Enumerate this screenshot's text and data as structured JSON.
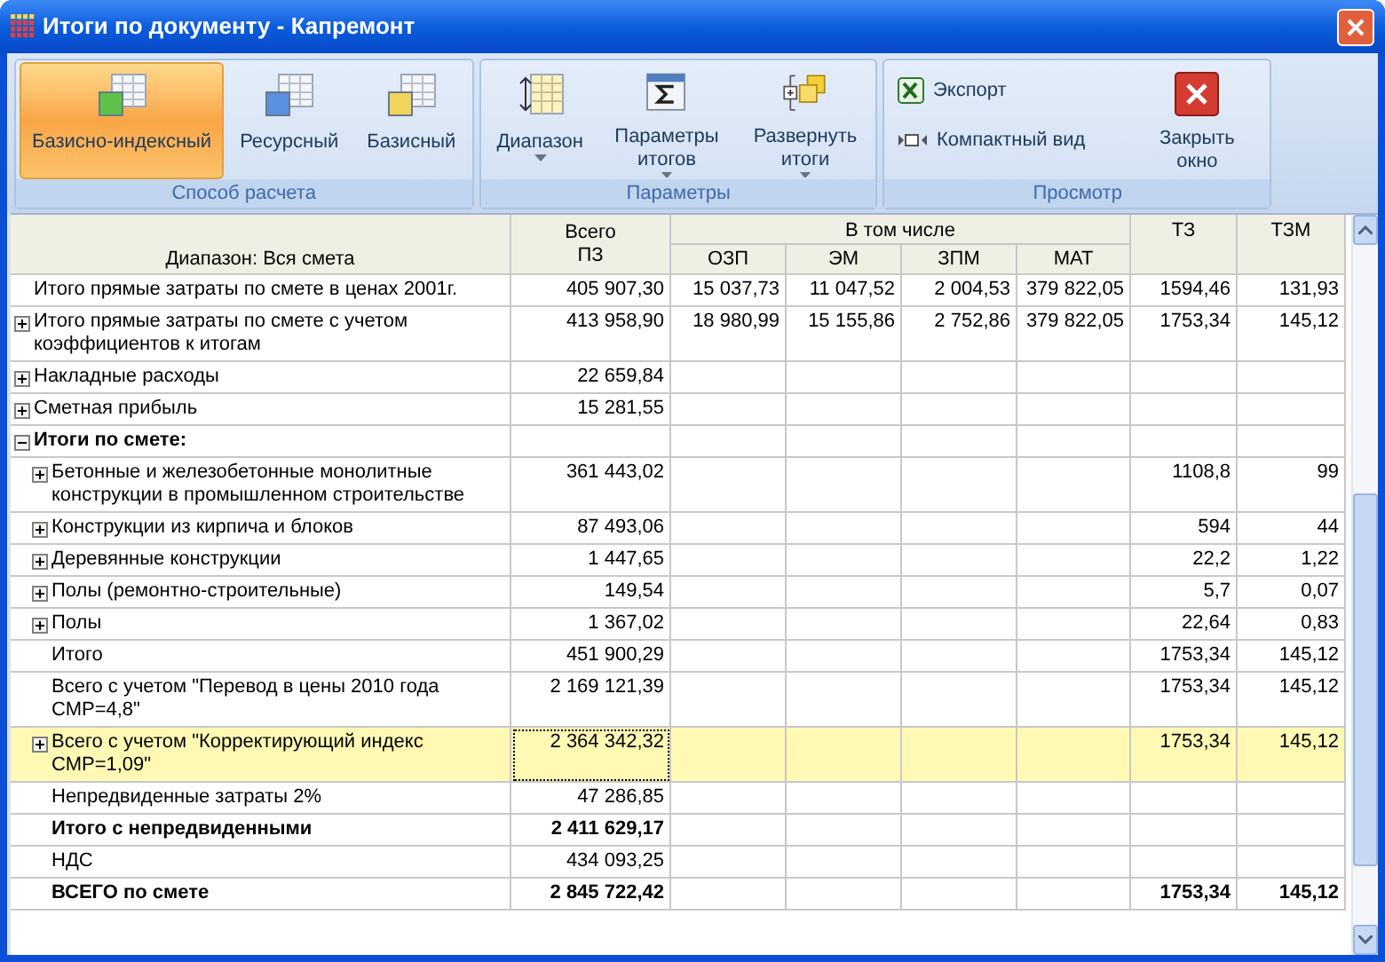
{
  "window": {
    "title": "Итоги по документу - Капремонт"
  },
  "ribbon": {
    "groups": [
      {
        "title": "Способ расчета",
        "buttons": [
          {
            "label": "Базисно-индексный",
            "kind": "large",
            "selected": true,
            "dropdown": false
          },
          {
            "label": "Ресурсный",
            "kind": "large",
            "selected": false,
            "dropdown": false
          },
          {
            "label": "Базисный",
            "kind": "large",
            "selected": false,
            "dropdown": false
          }
        ]
      },
      {
        "title": "Параметры",
        "buttons": [
          {
            "label": "Диапазон",
            "kind": "large",
            "selected": false,
            "dropdown": true
          },
          {
            "label": "Параметры итогов",
            "kind": "large",
            "selected": false,
            "dropdown": true
          },
          {
            "label": "Развернуть итоги",
            "kind": "large",
            "selected": false,
            "dropdown": true
          }
        ]
      },
      {
        "title": "Просмотр",
        "buttons": [
          {
            "label": "Экспорт",
            "kind": "small",
            "selected": false,
            "dropdown": false
          },
          {
            "label": "Компактный вид",
            "kind": "small",
            "selected": false,
            "dropdown": false
          },
          {
            "label": "Закрыть окно",
            "kind": "large",
            "selected": false,
            "dropdown": false
          }
        ]
      }
    ]
  },
  "table": {
    "header": {
      "range": "Диапазон: Вся смета",
      "total": "Всего ПЗ",
      "group": "В том числе",
      "sub_columns": [
        "ОЗП",
        "ЭМ",
        "ЗПМ",
        "МАТ"
      ],
      "tz": "ТЗ",
      "tzm": "ТЗМ"
    },
    "rows": [
      {
        "label": "Итого прямые затраты по смете в ценах 2001г.",
        "bold": false,
        "selected": false,
        "cells": {
          "total": "405 907,30",
          "ozp": "15 037,73",
          "em": "11 047,52",
          "zpm": "2 004,53",
          "mat": "379 822,05",
          "tz": "1594,46",
          "tzm": "131,93"
        }
      },
      {
        "label": "Итого прямые затраты по смете с учетом коэффициентов к итогам",
        "bold": false,
        "selected": false,
        "expanded": false,
        "cells": {
          "total": "413 958,90",
          "ozp": "18 980,99",
          "em": "15 155,86",
          "zpm": "2 752,86",
          "mat": "379 822,05",
          "tz": "1753,34",
          "tzm": "145,12"
        }
      },
      {
        "label": "Накладные расходы",
        "bold": false,
        "selected": false,
        "expanded": false,
        "cells": {
          "total": "22 659,84"
        }
      },
      {
        "label": "Сметная прибыль",
        "bold": false,
        "selected": false,
        "expanded": false,
        "cells": {
          "total": "15 281,55"
        }
      },
      {
        "label": "Итоги по смете:",
        "bold": true,
        "selected": false,
        "expanded": true,
        "cells": {},
        "children": [
          {
            "label": "Бетонные и железобетонные монолитные конструкции в промышленном строительстве",
            "bold": false,
            "selected": false,
            "expanded": false,
            "cells": {
              "total": "361 443,02",
              "tz": "1108,8",
              "tzm": "99"
            }
          },
          {
            "label": "Конструкции из кирпича и блоков",
            "bold": false,
            "selected": false,
            "expanded": false,
            "cells": {
              "total": "87 493,06",
              "tz": "594",
              "tzm": "44"
            }
          },
          {
            "label": "Деревянные конструкции",
            "bold": false,
            "selected": false,
            "expanded": false,
            "cells": {
              "total": "1 447,65",
              "tz": "22,2",
              "tzm": "1,22"
            }
          },
          {
            "label": "Полы (ремонтно-строительные)",
            "bold": false,
            "selected": false,
            "expanded": false,
            "cells": {
              "total": "149,54",
              "tz": "5,7",
              "tzm": "0,07"
            }
          },
          {
            "label": "Полы",
            "bold": false,
            "selected": false,
            "expanded": false,
            "cells": {
              "total": "1 367,02",
              "tz": "22,64",
              "tzm": "0,83"
            }
          },
          {
            "label": "Итого",
            "bold": false,
            "selected": false,
            "cells": {
              "total": "451 900,29",
              "tz": "1753,34",
              "tzm": "145,12"
            }
          },
          {
            "label": "Всего с учетом \"Перевод в цены 2010 года СМР=4,8\"",
            "bold": false,
            "selected": false,
            "cells": {
              "total": "2 169 121,39",
              "tz": "1753,34",
              "tzm": "145,12"
            }
          },
          {
            "label": "Всего с учетом \"Корректирующий индекс СМР=1,09\"",
            "bold": false,
            "selected": true,
            "expanded": false,
            "cells": {
              "total": "2 364 342,32",
              "tz": "1753,34",
              "tzm": "145,12"
            }
          },
          {
            "label": "Непредвиденные затраты 2%",
            "bold": false,
            "selected": false,
            "cells": {
              "total": "47 286,85"
            }
          },
          {
            "label": "Итого с непредвиденными",
            "bold": true,
            "selected": false,
            "cells": {
              "total": "2 411 629,17"
            }
          },
          {
            "label": "НДС",
            "bold": false,
            "selected": false,
            "cells": {
              "total": "434 093,25"
            }
          },
          {
            "label": "ВСЕГО по смете",
            "bold": true,
            "selected": false,
            "cells": {
              "total": "2 845 722,42",
              "tz": "1753,34",
              "tzm": "145,12"
            }
          }
        ]
      }
    ]
  }
}
